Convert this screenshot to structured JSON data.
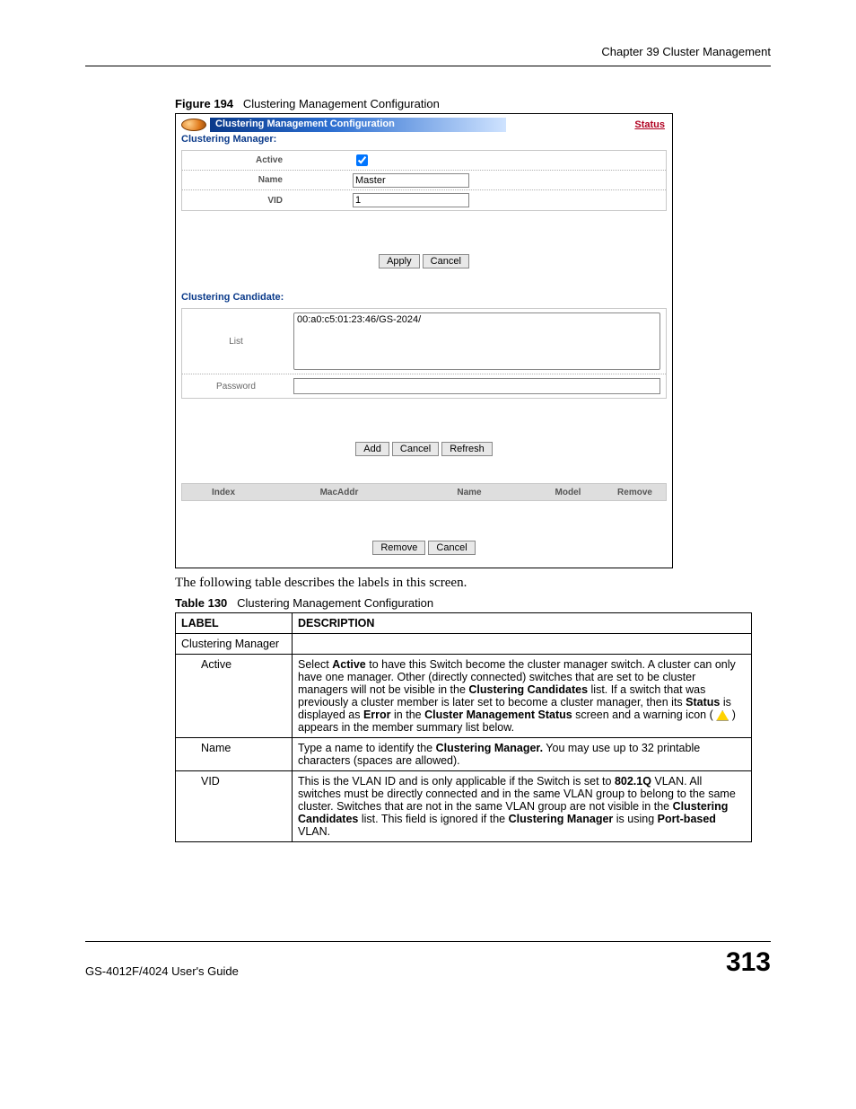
{
  "header": {
    "chapter": "Chapter 39 Cluster Management"
  },
  "figure": {
    "num": "Figure 194",
    "title": "Clustering Management Configuration"
  },
  "titlebar": {
    "title": "Clustering Management Configuration",
    "status": "Status"
  },
  "manager": {
    "section": "Clustering Manager:",
    "labels": {
      "active": "Active",
      "name": "Name",
      "vid": "VID"
    },
    "values": {
      "name": "Master",
      "vid": "1"
    },
    "buttons": {
      "apply": "Apply",
      "cancel": "Cancel"
    }
  },
  "candidate": {
    "section": "Clustering Candidate:",
    "labels": {
      "list": "List",
      "password": "Password"
    },
    "list_item": "00:a0:c5:01:23:46/GS-2024/",
    "buttons": {
      "add": "Add",
      "cancel": "Cancel",
      "refresh": "Refresh"
    }
  },
  "members": {
    "headers": {
      "index": "Index",
      "mac": "MacAddr",
      "name": "Name",
      "model": "Model",
      "remove": "Remove"
    },
    "buttons": {
      "remove": "Remove",
      "cancel": "Cancel"
    }
  },
  "explain": "The following table describes the labels in this screen.",
  "tablecap": {
    "num": "Table 130",
    "title": "Clustering Management Configuration"
  },
  "desc": {
    "headers": {
      "label": "LABEL",
      "description": "DESCRIPTION"
    },
    "rows": {
      "r0": {
        "label": "Clustering Manager",
        "desc": ""
      },
      "r1": {
        "label": "Active",
        "p1": "Select ",
        "b1": "Active",
        "p2": " to have this Switch become the cluster manager switch. A cluster can only have one manager. Other (directly connected) switches that are set to be cluster managers will not be visible in the ",
        "b2": "Clustering Candidates",
        "p3": " list. If a switch that was previously a cluster member is later set to become a cluster manager, then its ",
        "b3": "Status",
        "p4": " is displayed as ",
        "b4": "Error",
        "p5": " in the ",
        "b5": "Cluster Management Status",
        "p6": " screen and a warning icon ( ",
        "p7": " ) appears in the member summary list below."
      },
      "r2": {
        "label": "Name",
        "p1": "Type a name to identify the ",
        "b1": "Clustering Manager.",
        "p2": " You may use up to 32 printable characters (spaces are allowed)."
      },
      "r3": {
        "label": "VID",
        "p1": "This is the VLAN ID and is only applicable if the Switch is set to ",
        "b1": "802.1Q",
        "p2": " VLAN. All switches must be directly connected and in the same VLAN group to belong to the same cluster. Switches that are not in the same VLAN group are not visible in the ",
        "b2": "Clustering Candidates",
        "p3": " list. This field is ignored if the ",
        "b3": "Clustering Manager",
        "p4": " is using ",
        "b4": "Port-based",
        "p5": " VLAN."
      }
    }
  },
  "footer": {
    "guide": "GS-4012F/4024 User's Guide",
    "page": "313"
  }
}
